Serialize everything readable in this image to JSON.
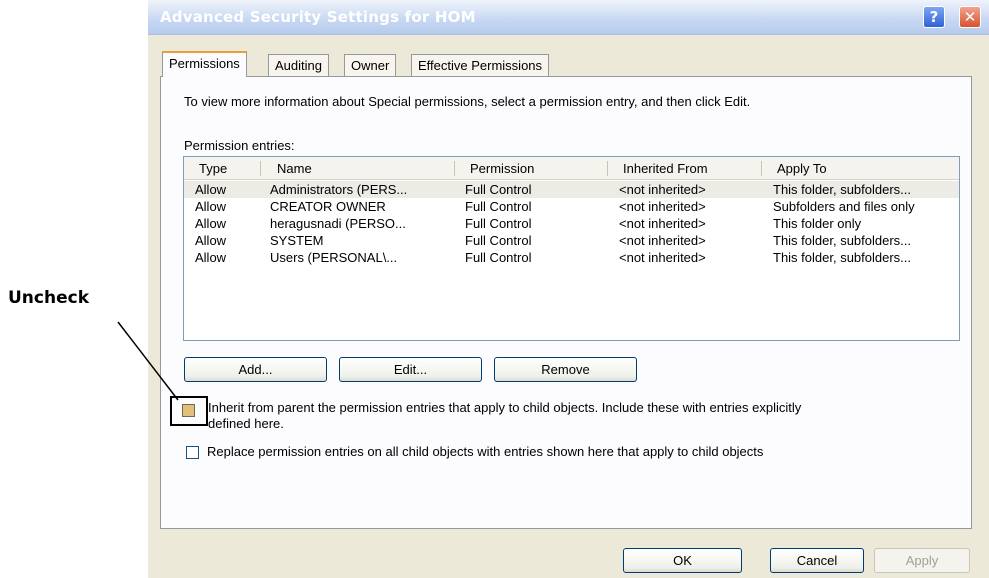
{
  "window": {
    "title": "Advanced Security Settings for HOM",
    "help_glyph": "?",
    "close_glyph": "✕"
  },
  "tabs": [
    {
      "label": "Permissions",
      "active": true
    },
    {
      "label": "Auditing",
      "active": false
    },
    {
      "label": "Owner",
      "active": false
    },
    {
      "label": "Effective Permissions",
      "active": false
    }
  ],
  "permissions": {
    "description": "To view more information about Special permissions, select a permission entry, and then click Edit.",
    "entries_label": "Permission entries:",
    "columns": [
      "Type",
      "Name",
      "Permission",
      "Inherited From",
      "Apply To"
    ],
    "rows": [
      [
        "Allow",
        "Administrators (PERS...",
        "Full Control",
        "<not inherited>",
        "This folder, subfolders..."
      ],
      [
        "Allow",
        "CREATOR OWNER",
        "Full Control",
        "<not inherited>",
        "Subfolders and files only"
      ],
      [
        "Allow",
        "heragusnadi (PERSO...",
        "Full Control",
        "<not inherited>",
        "This folder only"
      ],
      [
        "Allow",
        "SYSTEM",
        "Full Control",
        "<not inherited>",
        "This folder, subfolders..."
      ],
      [
        "Allow",
        "Users (PERSONAL\\...",
        "Full Control",
        "<not inherited>",
        "This folder, subfolders..."
      ]
    ],
    "add_label": "Add...",
    "edit_label": "Edit...",
    "remove_label": "Remove",
    "inherit_checkbox": {
      "line1": "Inherit from parent the permission entries that apply to child objects. Include these with entries explicitly",
      "line2": "defined here.",
      "checked": false
    },
    "replace_checkbox": {
      "label": "Replace permission entries on all child objects with entries shown here that apply to child objects",
      "checked": false
    }
  },
  "footer": {
    "ok_label": "OK",
    "cancel_label": "Cancel",
    "apply_label": "Apply"
  },
  "annotation": {
    "label": "Uncheck"
  },
  "colors": {
    "dialog_bg": "#ece9d8",
    "titlebar_text": "#ffffff",
    "active_tab_accent": "#e8a038",
    "highlight_checkbox": "#e3c07a"
  }
}
